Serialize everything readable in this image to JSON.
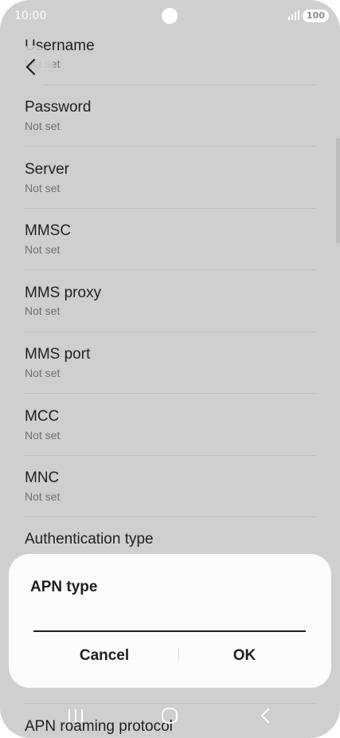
{
  "status_bar": {
    "time": "10:00",
    "battery": "100",
    "signal_icon": "signal-bars-icon"
  },
  "settings": [
    {
      "title": "Username",
      "value": "Not set"
    },
    {
      "title": "Password",
      "value": "Not set"
    },
    {
      "title": "Server",
      "value": "Not set"
    },
    {
      "title": "MMSC",
      "value": "Not set"
    },
    {
      "title": "MMS proxy",
      "value": "Not set"
    },
    {
      "title": "MMS port",
      "value": "Not set"
    },
    {
      "title": "MCC",
      "value": "Not set"
    },
    {
      "title": "MNC",
      "value": "Not set"
    },
    {
      "title": "Authentication type",
      "value": ""
    },
    {
      "title": "APN roaming protocol",
      "value": ""
    }
  ],
  "dialog": {
    "title": "APN type",
    "input_value": "",
    "cancel_label": "Cancel",
    "ok_label": "OK"
  },
  "nav_bar": {
    "recents_icon": "recents-icon",
    "home_icon": "home-icon",
    "back_icon": "back-nav-icon"
  },
  "colors": {
    "scrim_background": "#cfcfcf",
    "dialog_background": "#fcfcfc",
    "text_primary": "#202020",
    "text_secondary": "#6f6f6f",
    "divider": "#bdbdbd"
  }
}
